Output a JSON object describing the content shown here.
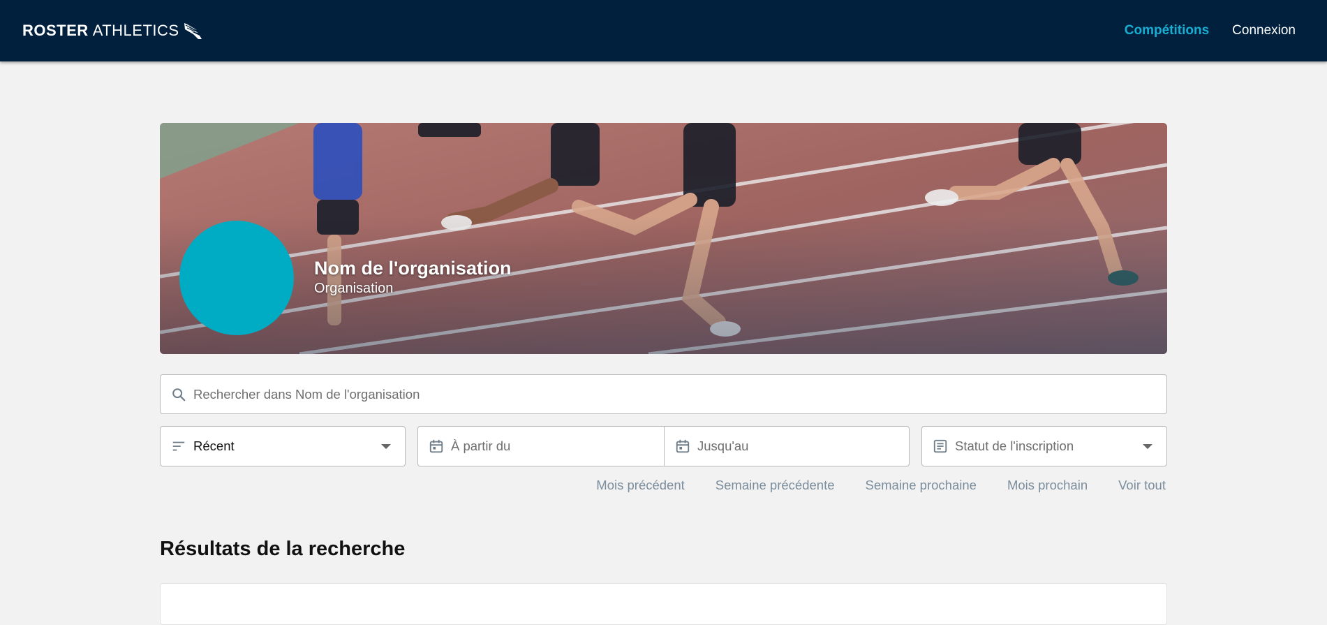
{
  "brand": {
    "bold": "ROSTER",
    "light": "ATHLETICS",
    "logo_icon": "winged-foot-icon"
  },
  "nav": {
    "competitions": "Compétitions",
    "login": "Connexion",
    "active_color": "#18aed3"
  },
  "colors": {
    "navbar": "#01203d",
    "accent": "#00abc4",
    "page_bg": "#f2f2f2"
  },
  "hero": {
    "org_name": "Nom de l'organisation",
    "org_type": "Organisation",
    "image_subject": "runners on athletics track"
  },
  "search": {
    "placeholder": "Rechercher dans Nom de l'organisation",
    "icon": "search-icon"
  },
  "filters": {
    "sort": {
      "value": "Récent",
      "icon": "sort-icon"
    },
    "date_from": {
      "placeholder": "À partir du",
      "icon": "calendar-icon"
    },
    "date_to": {
      "placeholder": "Jusqu'au",
      "icon": "calendar-icon"
    },
    "status": {
      "placeholder": "Statut de l'inscription",
      "icon": "list-icon"
    }
  },
  "quick_ranges": {
    "prev_month": "Mois précédent",
    "prev_week": "Semaine précédente",
    "next_week": "Semaine prochaine",
    "next_month": "Mois prochain",
    "all": "Voir tout"
  },
  "results": {
    "title": "Résultats de la recherche"
  }
}
